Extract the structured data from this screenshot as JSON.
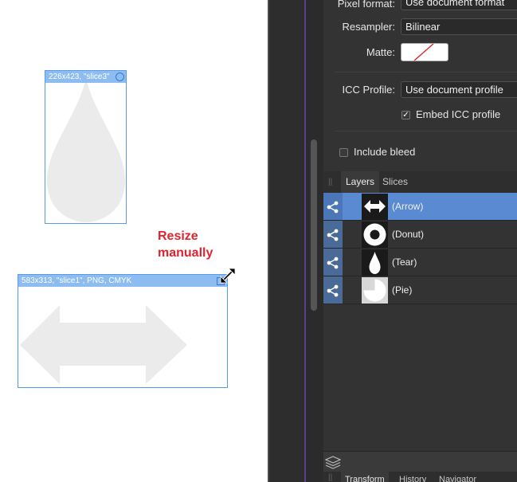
{
  "canvas": {
    "slices": [
      {
        "header": "226x423, \"slice3\""
      },
      {
        "header": "583x313, \"slice1\", PNG, CMYK"
      }
    ],
    "annotation": "Resize\nmanually"
  },
  "export_options": {
    "pixel_format": {
      "label": "Pixel format:",
      "value": "Use document format"
    },
    "resampler": {
      "label": "Resampler:",
      "value": "Bilinear"
    },
    "matte": {
      "label": "Matte:"
    },
    "icc_profile": {
      "label": "ICC Profile:",
      "value": "Use document profile"
    },
    "embed_icc": {
      "label": "Embed ICC profile",
      "checked": true,
      "mark": "✓"
    },
    "include_bleed": {
      "label": "Include bleed",
      "checked": false
    }
  },
  "layers_panel": {
    "tabs": [
      "Layers",
      "Slices"
    ],
    "active_tab": "Layers",
    "layers": [
      {
        "name": "(Arrow)",
        "icon": "arrow-icon",
        "selected": true
      },
      {
        "name": "(Donut)",
        "icon": "donut-icon",
        "selected": false
      },
      {
        "name": "(Tear)",
        "icon": "tear-icon",
        "selected": false
      },
      {
        "name": "(Pie)",
        "icon": "pie-icon",
        "selected": false
      }
    ]
  },
  "bottom_tabs": [
    "Transform",
    "History",
    "Navigator"
  ],
  "colors": {
    "selection_blue": "#5a8ad1",
    "slice_blue": "#8cbcf0",
    "annotation_red": "#e0232e",
    "panel_bg": "#333333",
    "gutter_accent": "#5b3e91"
  }
}
